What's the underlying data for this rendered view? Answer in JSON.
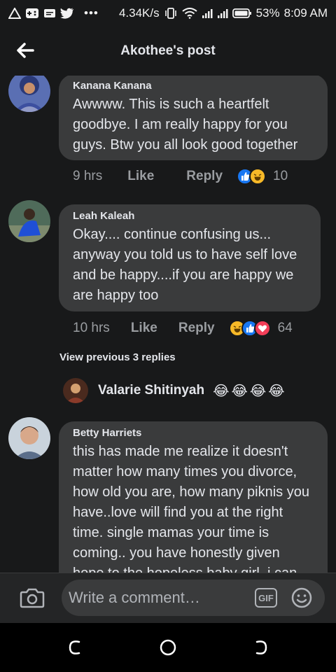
{
  "status_bar": {
    "speed": "4.34K/s",
    "dots": "•••",
    "battery": "53%",
    "time": "8:09 AM"
  },
  "header": {
    "title": "Akothee's post",
    "back_icon": "back-arrow-icon"
  },
  "comments": [
    {
      "author": "Kanana Kanana",
      "text": "Awwww. This is such a heartfelt goodbye. I am really happy for you guys. Btw you all look good together",
      "time": "9 hrs",
      "like_label": "Like",
      "reply_label": "Reply",
      "reactions": [
        "like",
        "haha"
      ],
      "reaction_count": "10"
    },
    {
      "author": "Leah Kaleah",
      "text": "Okay.... continue confusing us... anyway you told us to have self love and be happy....if you are happy we are happy too",
      "time": "10 hrs",
      "like_label": "Like",
      "reply_label": "Reply",
      "reactions": [
        "haha",
        "like",
        "love"
      ],
      "reaction_count": "64"
    },
    {
      "author": "Betty Harriets",
      "text": "this has made me realize it doesn't matter how many times you divorce, how old you are, how many piknis you have..love will find you at the right time. single mamas your time is coming.. you have honestly given hope to the hopeless baby girl. i can"
    }
  ],
  "view_previous": "View previous 3 replies",
  "reply_preview": {
    "name": "Valarie Shitinyah",
    "emojis": [
      "😂",
      "😂",
      "😂",
      "😂"
    ]
  },
  "composer": {
    "placeholder": "Write a comment…",
    "gif_label": "GIF"
  },
  "colors": {
    "background": "#18191a",
    "bubble": "#3a3b3c",
    "text": "#e4e6eb",
    "muted": "#9a9da1",
    "like_blue": "#1877f2",
    "love_red": "#f33e58",
    "haha_yellow": "#f7b928"
  }
}
